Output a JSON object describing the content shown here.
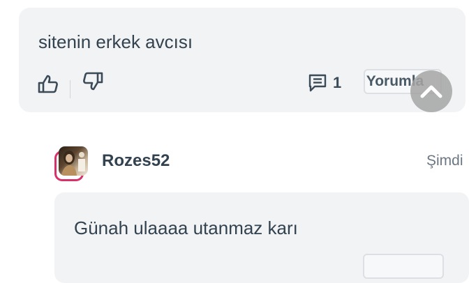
{
  "comment": {
    "text": "sitenin erkek avcısı",
    "reply_count": "1",
    "reply_button_label": "Yorumla"
  },
  "reply": {
    "username": "Rozes52",
    "timestamp": "Şimdi",
    "text": "Günah ulaaaa utanmaz karı"
  },
  "icons": {
    "like": "thumbs-up-icon",
    "dislike": "thumbs-down-icon",
    "comments": "comment-icon",
    "scroll_top": "chevron-up-icon"
  },
  "colors": {
    "card_background": "#f2f3f5",
    "text": "#33424f",
    "avatar_ring": "#d6326a",
    "scroll_button": "#a5a5a5"
  }
}
